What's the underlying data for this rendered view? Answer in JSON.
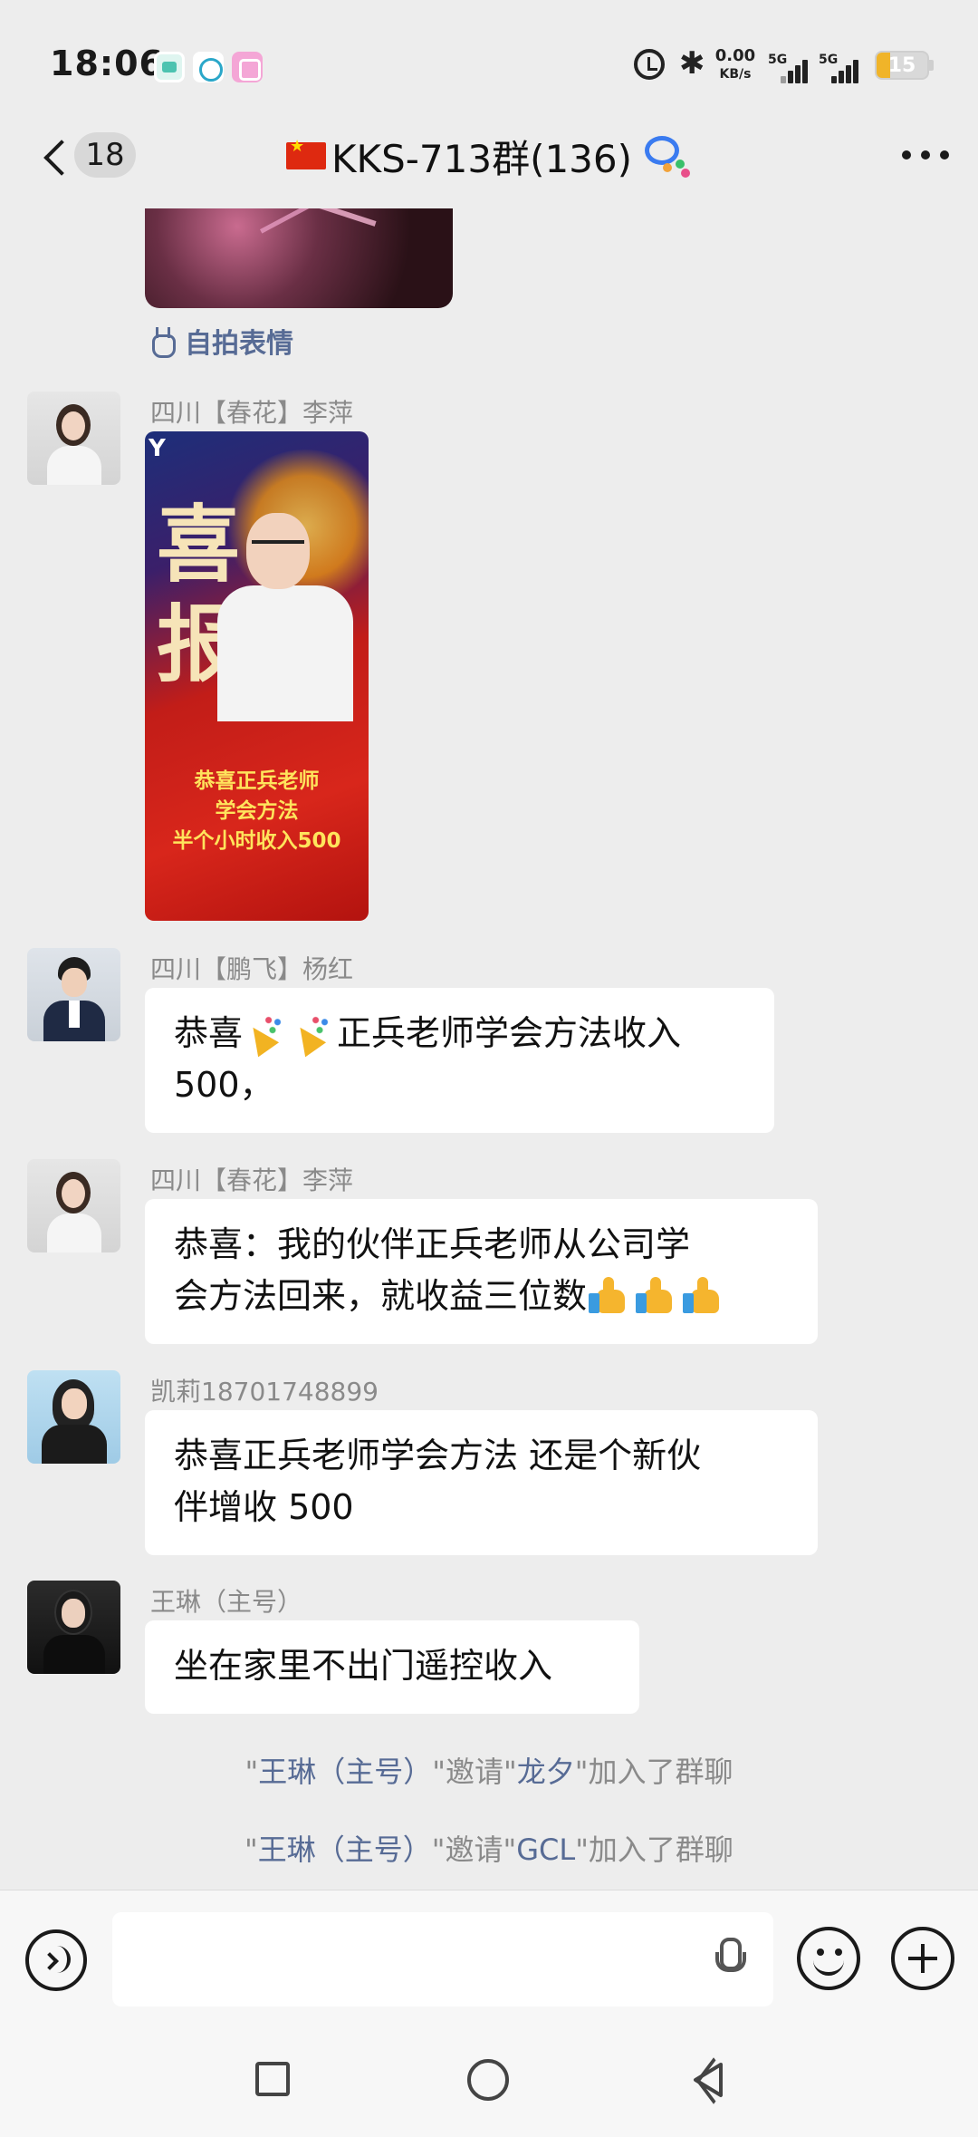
{
  "status_bar": {
    "time": "18:06",
    "net_speed_value": "0.00",
    "net_speed_unit": "KB/s",
    "sim1_label": "5G",
    "sim2_label": "5G",
    "battery": "15"
  },
  "header": {
    "back_count": "18",
    "title": "KKS-713群(136)"
  },
  "chat": {
    "selfie_sticker_link": "自拍表情",
    "messages": [
      {
        "sender": "四川【春花】李萍",
        "type": "image",
        "poster_caption_lines": [
          "恭喜正兵老师",
          "学会方法",
          "半个小时收入500"
        ],
        "poster_headline": "喜报"
      },
      {
        "sender": "四川【鹏飞】杨红",
        "text_a": "恭喜",
        "text_b": "正兵老师学会方法收入",
        "text_c": "500，"
      },
      {
        "sender": "四川【春花】李萍",
        "text_a": "恭喜：我的伙伴正兵老师从公司学",
        "text_b": "会方法回来，就收益三位数"
      },
      {
        "sender": "凯莉18701748899",
        "text_a": "恭喜正兵老师学会方法 还是个新伙",
        "text_b": "伴增收 500"
      },
      {
        "sender": "王琳（主号）",
        "text_a": "坐在家里不出门遥控收入"
      }
    ],
    "system_notices": [
      {
        "inviter": "王琳（主号）",
        "verb": "邀请",
        "invitee": "龙夕",
        "tail": "加入了群聊"
      },
      {
        "inviter": "王琳（主号）",
        "verb": "邀请",
        "invitee": "GCL",
        "tail": "加入了群聊"
      }
    ]
  },
  "input": {
    "value": ""
  },
  "icons": {
    "header_right": "more-icon",
    "title_badge": "chat-bubble-icon",
    "input_left": "voice-icon",
    "input_mic": "microphone-icon",
    "input_emoji": "emoji-icon",
    "input_plus": "plus-icon"
  },
  "colors": {
    "background": "#ededed",
    "bubble": "#ffffff",
    "link": "#576b95",
    "meta_text": "#8a8a8a"
  }
}
